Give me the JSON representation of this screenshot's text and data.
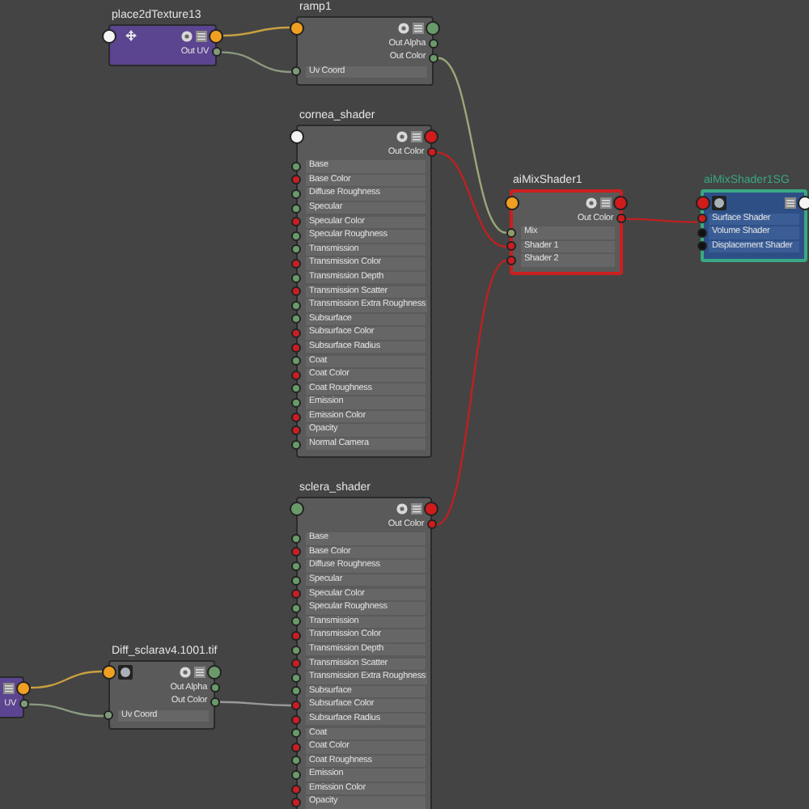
{
  "nodes": [
    {
      "title": "place2dTexture13",
      "kind": "place2d",
      "color": "#5b4490",
      "in_port": {
        "color": "#f4f4f4"
      },
      "out_port": {
        "color": "#f0a020"
      },
      "rows": [
        {
          "label": "Out UV",
          "kind": "output",
          "color": "#7f9a7a"
        }
      ]
    },
    {
      "title": "ramp1",
      "kind": "ramp",
      "color": "#5a5a5a",
      "in_port": {
        "color": "#f0a020"
      },
      "out_port": {
        "color": "#6a9a6a"
      },
      "rows": [
        {
          "label": "Out Alpha",
          "kind": "output",
          "color": "#6a9a6a"
        },
        {
          "label": "Out Color",
          "kind": "output",
          "color": "#6a9a6a"
        },
        {
          "label": "Uv Coord",
          "kind": "input",
          "color": "#7f9a7a"
        }
      ]
    },
    {
      "title": "cornea_shader",
      "kind": "shader",
      "color": "#5a5a5a",
      "in_port": {
        "color": "#f4f4f4"
      },
      "out_port": {
        "color": "#d01c1c"
      },
      "rows": [
        {
          "label": "Out Color",
          "kind": "output",
          "color": "#d01c1c"
        },
        {
          "label": "Base",
          "kind": "input",
          "color": "#6a9a6a"
        },
        {
          "label": "Base Color",
          "kind": "input",
          "color": "#c81e24"
        },
        {
          "label": "Diffuse Roughness",
          "kind": "input",
          "color": "#6a9a6a"
        },
        {
          "label": "Specular",
          "kind": "input",
          "color": "#6a9a6a"
        },
        {
          "label": "Specular Color",
          "kind": "input",
          "color": "#c81e24"
        },
        {
          "label": "Specular Roughness",
          "kind": "input",
          "color": "#6a9a6a"
        },
        {
          "label": "Transmission",
          "kind": "input",
          "color": "#6a9a6a"
        },
        {
          "label": "Transmission Color",
          "kind": "input",
          "color": "#c81e24"
        },
        {
          "label": "Transmission Depth",
          "kind": "input",
          "color": "#6a9a6a"
        },
        {
          "label": "Transmission Scatter",
          "kind": "input",
          "color": "#c81e24"
        },
        {
          "label": "Transmission Extra Roughness",
          "kind": "input",
          "color": "#6a9a6a"
        },
        {
          "label": "Subsurface",
          "kind": "input",
          "color": "#6a9a6a"
        },
        {
          "label": "Subsurface Color",
          "kind": "input",
          "color": "#c81e24"
        },
        {
          "label": "Subsurface Radius",
          "kind": "input",
          "color": "#c81e24"
        },
        {
          "label": "Coat",
          "kind": "input",
          "color": "#6a9a6a"
        },
        {
          "label": "Coat Color",
          "kind": "input",
          "color": "#c81e24"
        },
        {
          "label": "Coat Roughness",
          "kind": "input",
          "color": "#6a9a6a"
        },
        {
          "label": "Emission",
          "kind": "input",
          "color": "#6a9a6a"
        },
        {
          "label": "Emission Color",
          "kind": "input",
          "color": "#c81e24"
        },
        {
          "label": "Opacity",
          "kind": "input",
          "color": "#c81e24"
        },
        {
          "label": "Normal Camera",
          "kind": "input",
          "color": "#6a9a6a"
        }
      ]
    },
    {
      "title": "aiMixShader1",
      "kind": "mix",
      "color": "#5a5a5a",
      "border": {
        "color": "#cc1f1f"
      },
      "in_port": {
        "color": "#f0a020"
      },
      "out_port": {
        "color": "#d01c1c"
      },
      "rows": [
        {
          "label": "Out Color",
          "kind": "output",
          "color": "#d01c1c"
        },
        {
          "label": "Mix",
          "kind": "input",
          "color": "#8f9a6a"
        },
        {
          "label": "Shader 1",
          "kind": "input",
          "color": "#c81e24"
        },
        {
          "label": "Shader 2",
          "kind": "input",
          "color": "#c81e24"
        }
      ]
    },
    {
      "title": "aiMixShader1SG",
      "kind": "sg",
      "color": "#2d4f86",
      "border": {
        "color": "#3aa884"
      },
      "in_port": {
        "color": "#d01c1c"
      },
      "out_port": {
        "color": "#f4f4f4"
      },
      "rows": [
        {
          "label": "Surface Shader",
          "kind": "input",
          "color": "#d01c1c"
        },
        {
          "label": "Volume Shader",
          "kind": "input",
          "color": "#111111"
        },
        {
          "label": "Displacement Shader",
          "kind": "input",
          "color": "#111111"
        }
      ]
    },
    {
      "title": "sclera_shader",
      "kind": "shader",
      "color": "#5a5a5a",
      "in_port": {
        "color": "#6a9a6a"
      },
      "out_port": {
        "color": "#d01c1c"
      },
      "rows": [
        {
          "label": "Out Color",
          "kind": "output",
          "color": "#d01c1c"
        },
        {
          "label": "Base",
          "kind": "input",
          "color": "#6a9a6a"
        },
        {
          "label": "Base Color",
          "kind": "input",
          "color": "#c81e24"
        },
        {
          "label": "Diffuse Roughness",
          "kind": "input",
          "color": "#6a9a6a"
        },
        {
          "label": "Specular",
          "kind": "input",
          "color": "#6a9a6a"
        },
        {
          "label": "Specular Color",
          "kind": "input",
          "color": "#c81e24"
        },
        {
          "label": "Specular Roughness",
          "kind": "input",
          "color": "#6a9a6a"
        },
        {
          "label": "Transmission",
          "kind": "input",
          "color": "#6a9a6a"
        },
        {
          "label": "Transmission Color",
          "kind": "input",
          "color": "#c81e24"
        },
        {
          "label": "Transmission Depth",
          "kind": "input",
          "color": "#6a9a6a"
        },
        {
          "label": "Transmission Scatter",
          "kind": "input",
          "color": "#c81e24"
        },
        {
          "label": "Transmission Extra Roughness",
          "kind": "input",
          "color": "#6a9a6a"
        },
        {
          "label": "Subsurface",
          "kind": "input",
          "color": "#6a9a6a"
        },
        {
          "label": "Subsurface Color",
          "kind": "input",
          "color": "#c81e24"
        },
        {
          "label": "Subsurface Radius",
          "kind": "input",
          "color": "#c81e24"
        },
        {
          "label": "Coat",
          "kind": "input",
          "color": "#6a9a6a"
        },
        {
          "label": "Coat Color",
          "kind": "input",
          "color": "#c81e24"
        },
        {
          "label": "Coat Roughness",
          "kind": "input",
          "color": "#6a9a6a"
        },
        {
          "label": "Emission",
          "kind": "input",
          "color": "#6a9a6a"
        },
        {
          "label": "Emission Color",
          "kind": "input",
          "color": "#c81e24"
        },
        {
          "label": "Opacity",
          "kind": "input",
          "color": "#c81e24"
        }
      ]
    },
    {
      "title": "Diff_sclarav4.1001.tif",
      "kind": "file",
      "color": "#5a5a5a",
      "in_port": {
        "color": "#f0a020"
      },
      "out_port": {
        "color": "#6a9a6a"
      },
      "rows": [
        {
          "label": "Out Alpha",
          "kind": "output",
          "color": "#6a9a6a"
        },
        {
          "label": "Out Color",
          "kind": "output",
          "color": "#6a9a6a"
        },
        {
          "label": "Uv Coord",
          "kind": "input",
          "color": "#7f9a7a"
        }
      ]
    },
    {
      "kind": "partial",
      "color": "#5b4490",
      "out_port": {
        "color": "#f0a020"
      },
      "rows": [
        {
          "label": "UV",
          "kind": "output",
          "color": "#7f9a7a"
        }
      ]
    }
  ]
}
